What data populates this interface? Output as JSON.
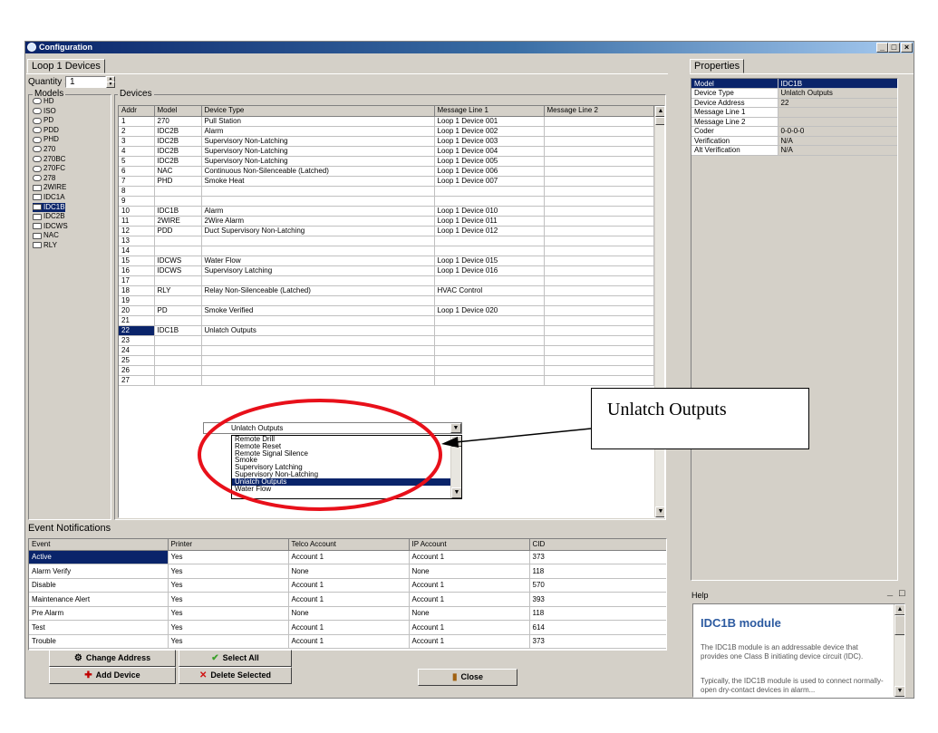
{
  "window": {
    "title": "Configuration",
    "caption_buttons": [
      "_",
      "□",
      "×"
    ]
  },
  "left_tab": "Loop 1 Devices",
  "quantity": {
    "label": "Quantity :",
    "value": "1"
  },
  "models": {
    "title": "Models",
    "items": [
      "HD",
      "ISO",
      "PD",
      "PDD",
      "PHD",
      "270",
      "270BC",
      "270FC",
      "278",
      "2WIRE",
      "IDC1A",
      "IDC1B",
      "IDC2B",
      "IDCWS",
      "NAC",
      "RLY"
    ],
    "selected": "IDC1B"
  },
  "devices": {
    "title": "Devices",
    "columns": [
      "Addr",
      "Model",
      "Device Type",
      "Message Line 1",
      "Message Line 2"
    ],
    "rows": [
      [
        "1",
        "270",
        "Pull Station",
        "Loop 1 Device 001",
        ""
      ],
      [
        "2",
        "IDC2B",
        "Alarm",
        "Loop 1 Device 002",
        ""
      ],
      [
        "3",
        "IDC2B",
        "Supervisory Non-Latching",
        "Loop 1 Device 003",
        ""
      ],
      [
        "4",
        "IDC2B",
        "Supervisory Non-Latching",
        "Loop 1 Device 004",
        ""
      ],
      [
        "5",
        "IDC2B",
        "Supervisory Non-Latching",
        "Loop 1 Device 005",
        ""
      ],
      [
        "6",
        "NAC",
        "Continuous Non-Silenceable (Latched)",
        "Loop 1 Device 006",
        ""
      ],
      [
        "7",
        "PHD",
        "Smoke Heat",
        "Loop 1 Device 007",
        ""
      ],
      [
        "8",
        "",
        "",
        "",
        ""
      ],
      [
        "9",
        "",
        "",
        "",
        ""
      ],
      [
        "10",
        "IDC1B",
        "Alarm",
        "Loop 1 Device 010",
        ""
      ],
      [
        "11",
        "2WIRE",
        "2Wire Alarm",
        "Loop 1 Device 011",
        ""
      ],
      [
        "12",
        "PDD",
        "Duct Supervisory Non-Latching",
        "Loop 1 Device 012",
        ""
      ],
      [
        "13",
        "",
        "",
        "",
        ""
      ],
      [
        "14",
        "",
        "",
        "",
        ""
      ],
      [
        "15",
        "IDCWS",
        "Water Flow",
        "Loop 1 Device 015",
        ""
      ],
      [
        "16",
        "IDCWS",
        "Supervisory Latching",
        "Loop 1 Device 016",
        ""
      ],
      [
        "17",
        "",
        "",
        "",
        ""
      ],
      [
        "18",
        "RLY",
        "Relay Non-Silenceable (Latched)",
        "HVAC Control",
        ""
      ],
      [
        "19",
        "",
        "",
        "",
        ""
      ],
      [
        "20",
        "PD",
        "Smoke Verified",
        "Loop 1 Device 020",
        ""
      ],
      [
        "21",
        "",
        "",
        "",
        ""
      ],
      [
        "22",
        "IDC1B",
        "Unlatch Outputs",
        "",
        ""
      ],
      [
        "23",
        "",
        "",
        "",
        ""
      ],
      [
        "24",
        "",
        "",
        "",
        ""
      ],
      [
        "25",
        "",
        "",
        "",
        ""
      ],
      [
        "26",
        "",
        "",
        "",
        ""
      ],
      [
        "27",
        "",
        "",
        "",
        ""
      ]
    ],
    "selected_addr": "22"
  },
  "device_type_dropdown": {
    "value": "Unlatch Outputs",
    "options": [
      "Remote Drill",
      "Remote Reset",
      "Remote Signal Silence",
      "Smoke",
      "Supervisory Latching",
      "Supervisory Non-Latching",
      "Unlatch Outputs",
      "Water Flow"
    ],
    "selected": "Unlatch Outputs"
  },
  "event_notifications": {
    "title": "Event Notifications",
    "columns": [
      "Event",
      "Printer",
      "Telco Account",
      "IP Account",
      "CID"
    ],
    "rows": [
      [
        "Active",
        "Yes",
        "Account 1",
        "Account 1",
        "373"
      ],
      [
        "Alarm Verify",
        "Yes",
        "None",
        "None",
        "118"
      ],
      [
        "Disable",
        "Yes",
        "Account 1",
        "Account 1",
        "570"
      ],
      [
        "Maintenance Alert",
        "Yes",
        "Account 1",
        "Account 1",
        "393"
      ],
      [
        "Pre Alarm",
        "Yes",
        "None",
        "None",
        "118"
      ],
      [
        "Test",
        "Yes",
        "Account 1",
        "Account 1",
        "614"
      ],
      [
        "Trouble",
        "Yes",
        "Account 1",
        "Account 1",
        "373"
      ]
    ]
  },
  "buttons": {
    "change_address": "Change Address",
    "select_all": "Select All",
    "add_device": "Add Device",
    "delete_selected": "Delete Selected",
    "close": "Close"
  },
  "properties": {
    "tab": "Properties",
    "header": [
      "Model",
      "IDC1B"
    ],
    "rows": [
      [
        "Device Type",
        "Unlatch Outputs"
      ],
      [
        "Device Address",
        "22"
      ],
      [
        "Message Line 1",
        ""
      ],
      [
        "Message Line 2",
        ""
      ],
      [
        "Coder",
        "0-0-0-0"
      ],
      [
        "Verification",
        "N/A"
      ],
      [
        "Alt Verification",
        "N/A"
      ]
    ]
  },
  "help": {
    "label": "Help",
    "minimize": "_",
    "restore": "□",
    "heading": "IDC1B module",
    "para1": "The IDC1B module is an addressable device that provides one Class B initiating device circuit (IDC).",
    "para2": "Typically, the IDC1B module is used to connect normally-open dry-contact devices in alarm..."
  },
  "callout": {
    "text": "Unlatch Outputs"
  },
  "colors": {
    "highlight": "#0a246a",
    "face": "#d4d0c8",
    "annotation": "#e8101a"
  }
}
